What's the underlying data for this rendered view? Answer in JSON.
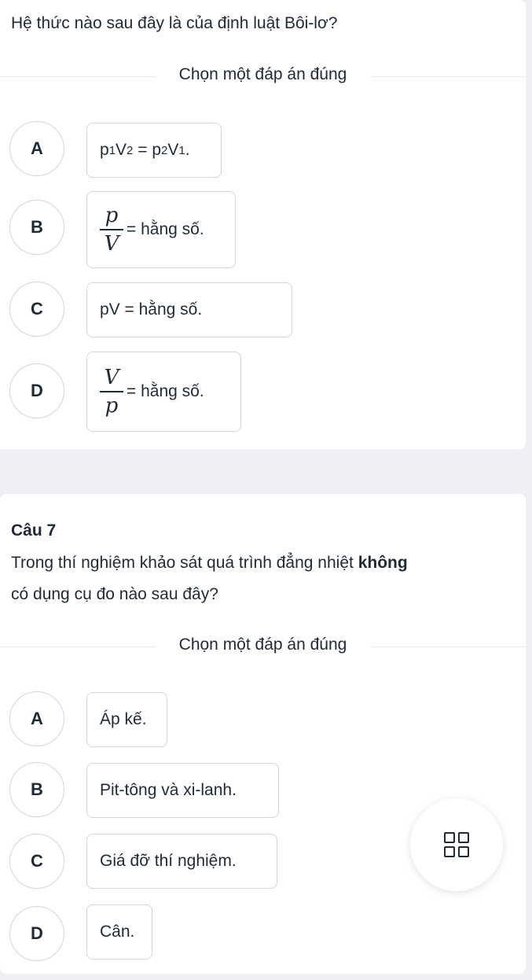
{
  "q6": {
    "question": "Hệ thức nào sau đây là của định luật Bôi-lơ?",
    "choose_label": "Chọn một đáp án đúng",
    "options": [
      {
        "letter": "A",
        "p1": "p",
        "s1": "1",
        "v2": "V",
        "s2": "2",
        "eq": " = ",
        "p2": "p",
        "s3": "2",
        "v1": "V",
        "s4": "1",
        "end": "."
      },
      {
        "letter": "B",
        "num": "p",
        "den": "V",
        "text": "= hằng số."
      },
      {
        "letter": "C",
        "text": "pV = hằng số."
      },
      {
        "letter": "D",
        "num": "V",
        "den": "p",
        "text": "= hằng số."
      }
    ]
  },
  "q7": {
    "number": "Câu 7",
    "question_part1": "Trong thí nghiệm khảo sát quá trình đẳng nhiệt ",
    "question_bold": "không",
    "question_part2": "có dụng cụ đo nào sau đây?",
    "choose_label": "Chọn một đáp án đúng",
    "options": [
      {
        "letter": "A",
        "text": "Áp kế."
      },
      {
        "letter": "B",
        "text": "Pit-tông và xi-lanh."
      },
      {
        "letter": "C",
        "text": "Giá đỡ thí nghiệm."
      },
      {
        "letter": "D",
        "text": "Cân."
      }
    ]
  },
  "fab": {
    "icon": "grid-icon"
  }
}
